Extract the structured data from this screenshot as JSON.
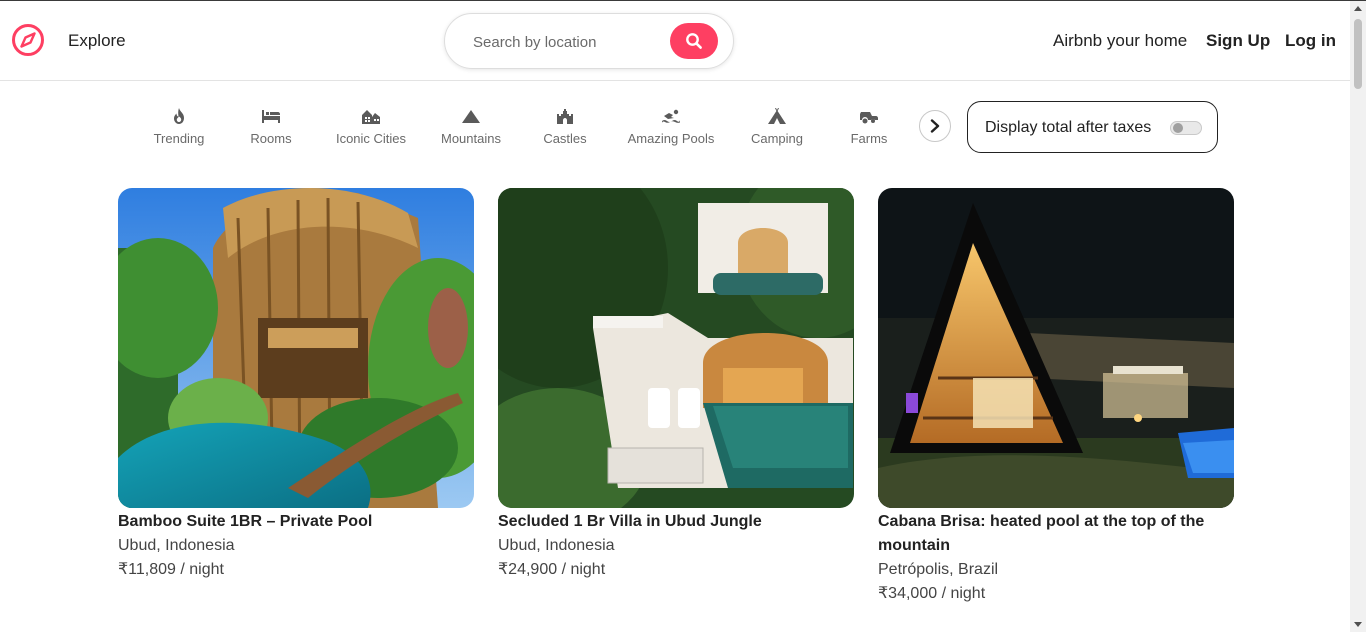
{
  "header": {
    "explore_label": "Explore",
    "search_placeholder": "Search by location",
    "host_label": "Airbnb your home",
    "signup_label": "Sign Up",
    "login_label": "Log in",
    "brand_color": "#fe3f62"
  },
  "filters": {
    "items": [
      {
        "label": "Trending",
        "icon": "flame-icon"
      },
      {
        "label": "Rooms",
        "icon": "bed-icon"
      },
      {
        "label": "Iconic Cities",
        "icon": "city-icon"
      },
      {
        "label": "Mountains",
        "icon": "mountain-icon"
      },
      {
        "label": "Castles",
        "icon": "castle-icon"
      },
      {
        "label": "Amazing Pools",
        "icon": "swimmer-icon"
      },
      {
        "label": "Camping",
        "icon": "tent-icon"
      },
      {
        "label": "Farms",
        "icon": "tractor-icon"
      }
    ],
    "next_icon": "chevron-right-icon",
    "tax_toggle_label": "Display total after taxes",
    "tax_toggle_on": false
  },
  "listings": [
    {
      "title": "Bamboo Suite 1BR – Private Pool",
      "location": "Ubud, Indonesia",
      "price": "₹11,809 / night"
    },
    {
      "title": "Secluded 1 Br Villa in Ubud Jungle",
      "location": "Ubud, Indonesia",
      "price": "₹24,900 / night"
    },
    {
      "title": "Cabana Brisa: heated pool at the top of the mountain",
      "location": "Petrópolis, Brazil",
      "price": "₹34,000 / night"
    }
  ]
}
